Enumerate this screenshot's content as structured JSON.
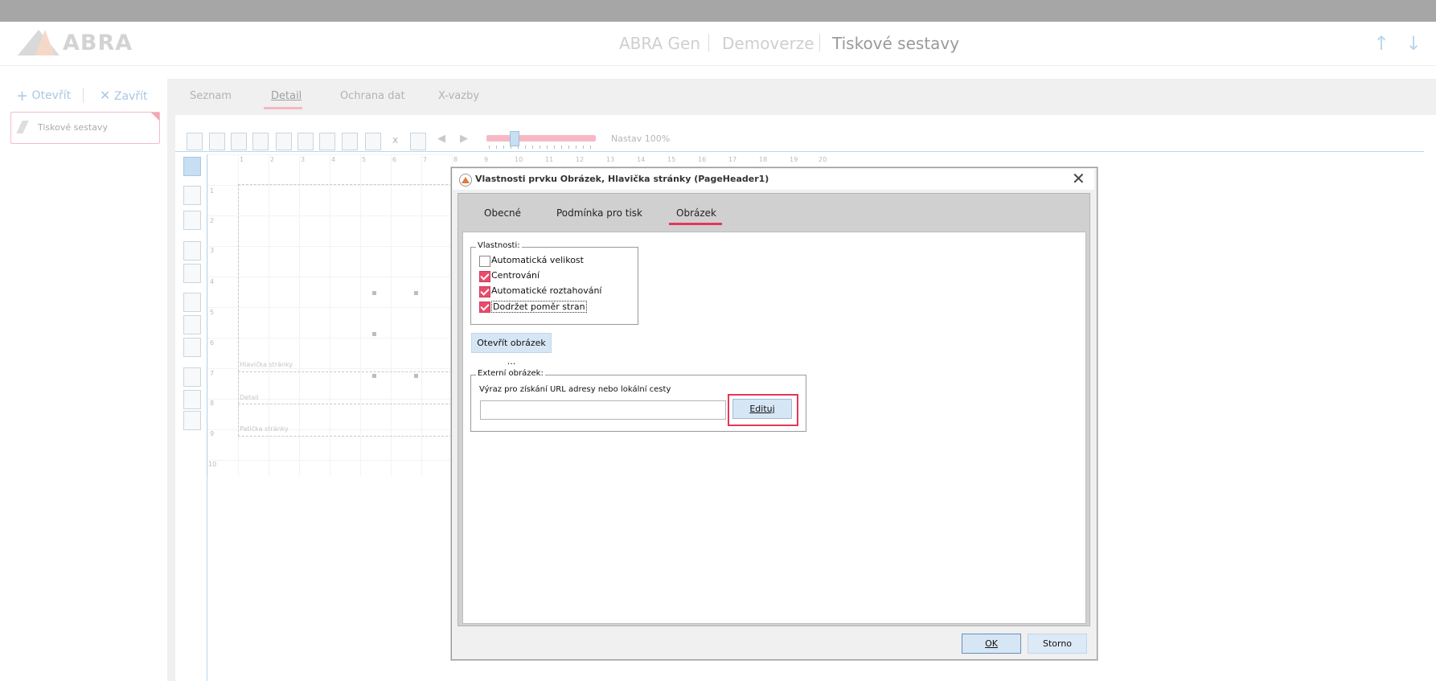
{
  "app": {
    "logo_text": "ABRA",
    "breadcrumbs": [
      "ABRA Gen",
      "Demoverze",
      "Tiskové sestavy"
    ]
  },
  "left_panel": {
    "open_label": "Otevřít",
    "close_label": "Zavřít",
    "item_label": "Tiskové sestavy"
  },
  "tabs": [
    "Seznam",
    "Detail",
    "Ochrana dat",
    "X-vazby"
  ],
  "toolbar": {
    "zoom_label": "Nastav 100%",
    "x_label": "x"
  },
  "ruler": {
    "horizontal": [
      "1",
      "2",
      "3",
      "4",
      "5",
      "6",
      "7",
      "8",
      "9",
      "10",
      "11",
      "12",
      "13",
      "14",
      "15",
      "16",
      "17",
      "18",
      "19",
      "20"
    ],
    "vertical": [
      "1",
      "2",
      "3",
      "4",
      "5",
      "6",
      "7",
      "8",
      "9",
      "10"
    ]
  },
  "bands": {
    "page_header": "Hlavička stránky",
    "detail": "Detail",
    "page_footer": "Patička stránky"
  },
  "dialog": {
    "title": "Vlastnosti prvku Obrázek, Hlavička stránky (PageHeader1)",
    "tabs": [
      "Obecné",
      "Podmínka pro tisk",
      "Obrázek"
    ],
    "active_tab": "Obrázek",
    "properties_group": "Vlastnosti:",
    "properties": [
      {
        "label": "Automatická velikost",
        "checked": false
      },
      {
        "label": "Centrování",
        "checked": true
      },
      {
        "label": "Automatické roztahování",
        "checked": true
      },
      {
        "label": "Dodržet poměr stran",
        "checked": true
      }
    ],
    "open_image_button": "Otevřít obrázek ...",
    "external_group": "Externí obrázek:",
    "external_desc": "Výraz pro získání URL adresy nebo lokální cesty",
    "external_value": "",
    "edit_button": "Edituj",
    "ok_button": "OK",
    "cancel_button": "Storno"
  },
  "colors": {
    "accent": "#e2385a",
    "button_bg": "#d6e6f5"
  }
}
